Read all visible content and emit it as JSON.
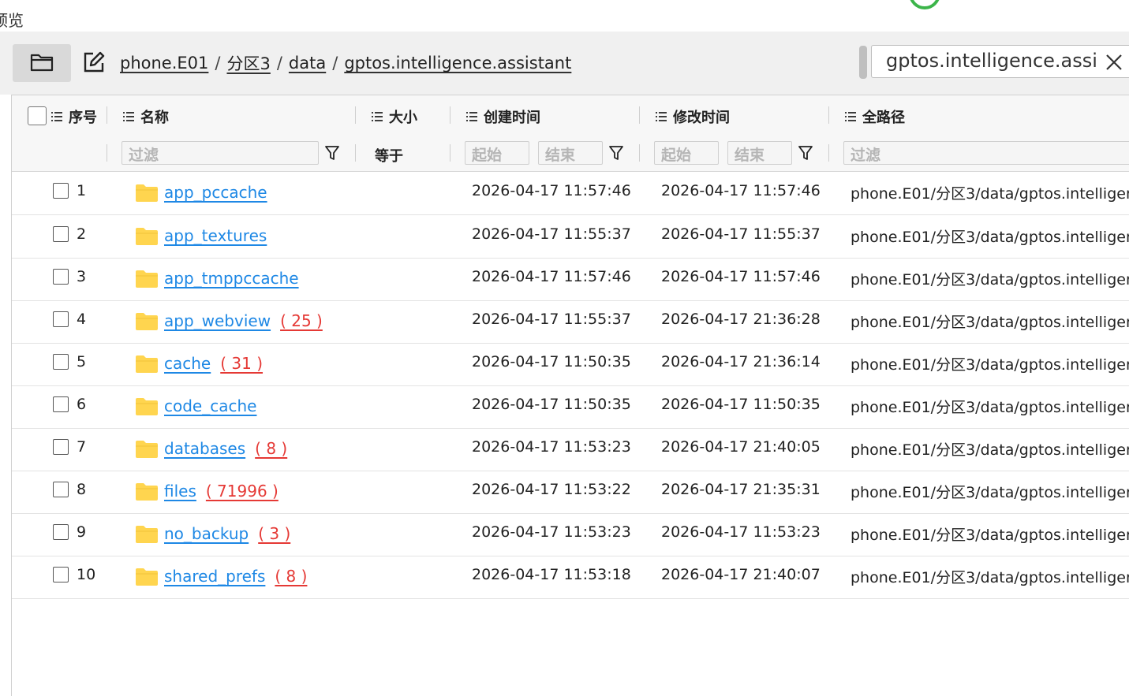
{
  "window": {
    "title_fragment": "预览"
  },
  "toolbar": {
    "breadcrumb": [
      "phone.E01",
      "分区3",
      "data",
      "gptos.intelligence.assistant"
    ],
    "search_value": "gptos.intelligence.assist"
  },
  "table": {
    "columns": {
      "index": "序号",
      "name": "名称",
      "size": "大小",
      "created": "创建时间",
      "modified": "修改时间",
      "path": "全路径"
    },
    "filters": {
      "name_placeholder": "过滤",
      "size_mode": "等于",
      "created_start": "起始",
      "created_end": "结束",
      "modified_start": "起始",
      "modified_end": "结束",
      "path_placeholder": "过滤"
    },
    "rows": [
      {
        "index": "1",
        "name": "app_pccache",
        "count": "",
        "created": "2026-04-17 11:57:46",
        "modified": "2026-04-17 11:57:46",
        "path": "phone.E01/分区3/data/gptos.intelligen"
      },
      {
        "index": "2",
        "name": "app_textures",
        "count": "",
        "created": "2026-04-17 11:55:37",
        "modified": "2026-04-17 11:55:37",
        "path": "phone.E01/分区3/data/gptos.intelligen"
      },
      {
        "index": "3",
        "name": "app_tmppccache",
        "count": "",
        "created": "2026-04-17 11:57:46",
        "modified": "2026-04-17 11:57:46",
        "path": "phone.E01/分区3/data/gptos.intelligen"
      },
      {
        "index": "4",
        "name": "app_webview",
        "count": "( 25 )",
        "created": "2026-04-17 11:55:37",
        "modified": "2026-04-17 21:36:28",
        "path": "phone.E01/分区3/data/gptos.intelligen"
      },
      {
        "index": "5",
        "name": "cache",
        "count": "( 31 )",
        "created": "2026-04-17 11:50:35",
        "modified": "2026-04-17 21:36:14",
        "path": "phone.E01/分区3/data/gptos.intelligen"
      },
      {
        "index": "6",
        "name": "code_cache",
        "count": "",
        "created": "2026-04-17 11:50:35",
        "modified": "2026-04-17 11:50:35",
        "path": "phone.E01/分区3/data/gptos.intelligen"
      },
      {
        "index": "7",
        "name": "databases",
        "count": "( 8 )",
        "created": "2026-04-17 11:53:23",
        "modified": "2026-04-17 21:40:05",
        "path": "phone.E01/分区3/data/gptos.intelligen"
      },
      {
        "index": "8",
        "name": "files",
        "count": "( 71996 )",
        "created": "2026-04-17 11:53:22",
        "modified": "2026-04-17 21:35:31",
        "path": "phone.E01/分区3/data/gptos.intelligen"
      },
      {
        "index": "9",
        "name": "no_backup",
        "count": "( 3 )",
        "created": "2026-04-17 11:53:23",
        "modified": "2026-04-17 11:53:23",
        "path": "phone.E01/分区3/data/gptos.intelligen"
      },
      {
        "index": "10",
        "name": "shared_prefs",
        "count": "( 8 )",
        "created": "2026-04-17 11:53:18",
        "modified": "2026-04-17 21:40:07",
        "path": "phone.E01/分区3/data/gptos.intelligen"
      }
    ]
  },
  "colors": {
    "link": "#1e88e5",
    "count": "#e53935",
    "folder": "#ffd54f",
    "status_ring": "#3cb54a"
  },
  "icons": [
    "folder-icon",
    "edit-icon",
    "close-icon",
    "menu-icon",
    "filter-icon",
    "checkbox-icon"
  ]
}
